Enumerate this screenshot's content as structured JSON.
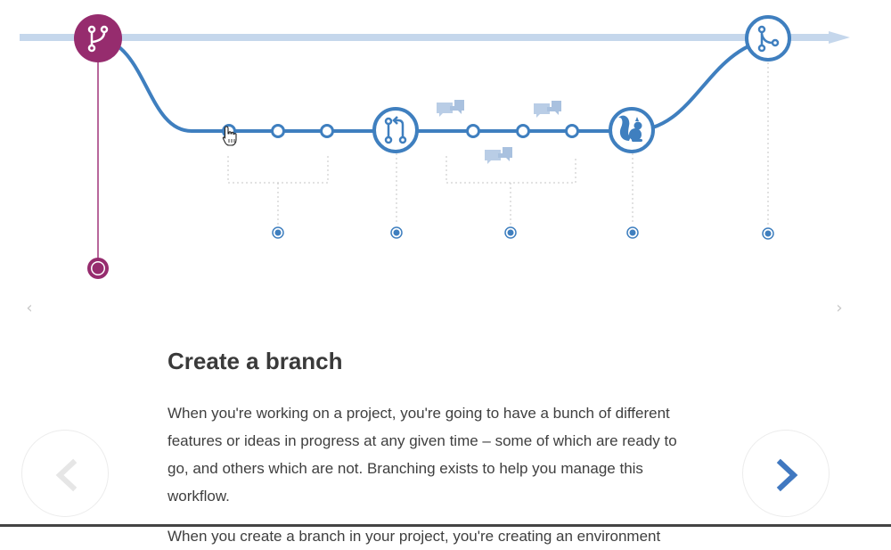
{
  "step": {
    "title": "Create a branch",
    "paragraph1": "When you're working on a project, you're going to have a bunch of different features or ideas in progress at any given time – some of which are ready to go, and others which are not. Branching exists to help you manage this workflow.",
    "paragraph2": "When you create a branch in your project, you're creating an environment"
  },
  "navigation": {
    "mini_prev_glyph": "‹",
    "mini_next_glyph": "›"
  },
  "icons": {
    "start": "branch-icon",
    "pull_request": "pull-request-icon",
    "comments": "speech-bubbles-icon",
    "deploy": "squirrel-icon",
    "merge": "merge-icon",
    "cursor": "hand-pointer-icon"
  },
  "colors": {
    "branch_line": "#3f7fbf",
    "master_line": "#c5d7ec",
    "start_node": "#962c6e",
    "comment_icon": "#b9cde6",
    "next_arrow": "#4078c0",
    "prev_arrow": "#e6e6e6",
    "heading": "#3a3a3a",
    "body_text": "#3f3f3f"
  }
}
